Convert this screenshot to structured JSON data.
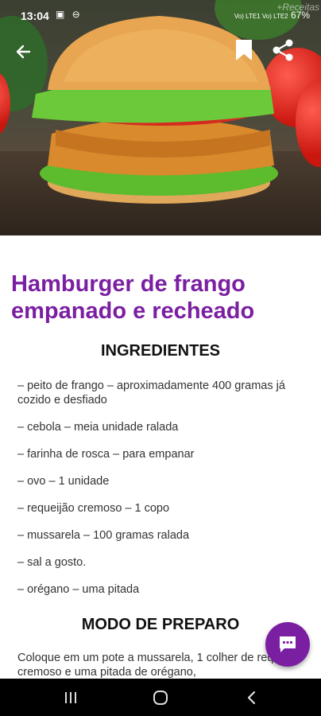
{
  "status_bar": {
    "time": "13:04",
    "left_icons": "▣ ⊖",
    "network": "Vo) LTE1 Vo) LTE2",
    "battery": "67%"
  },
  "hero": {
    "watermark": "+Receitas",
    "back_icon": "arrow-left-icon",
    "bookmark_icon": "bookmark-icon",
    "share_icon": "share-icon"
  },
  "recipe": {
    "title": "Hamburger de frango empanado e recheado",
    "ingredients_heading": "INGREDIENTES",
    "ingredients": [
      "– peito de frango – aproximadamente 400 gramas já cozido e desfiado",
      "– cebola – meia unidade ralada",
      "– farinha de rosca – para empanar",
      "– ovo – 1 unidade",
      "– requeijão cremoso – 1 copo",
      "– mussarela – 100 gramas ralada",
      "– sal a gosto.",
      "– orégano – uma pitada"
    ],
    "preparation_heading": "MODO DE PREPARO",
    "preparation_text": "Coloque em um pote a mussarela, 1 colher de requeijão cremoso e uma pitada de orégano,"
  },
  "fab": {
    "icon": "chat-icon"
  },
  "nav_bar": {
    "recents_icon": "recents-icon",
    "home_icon": "home-icon",
    "back_icon": "back-icon"
  },
  "colors": {
    "accent": "#7b1fa2",
    "nav_bar": "#000000"
  }
}
